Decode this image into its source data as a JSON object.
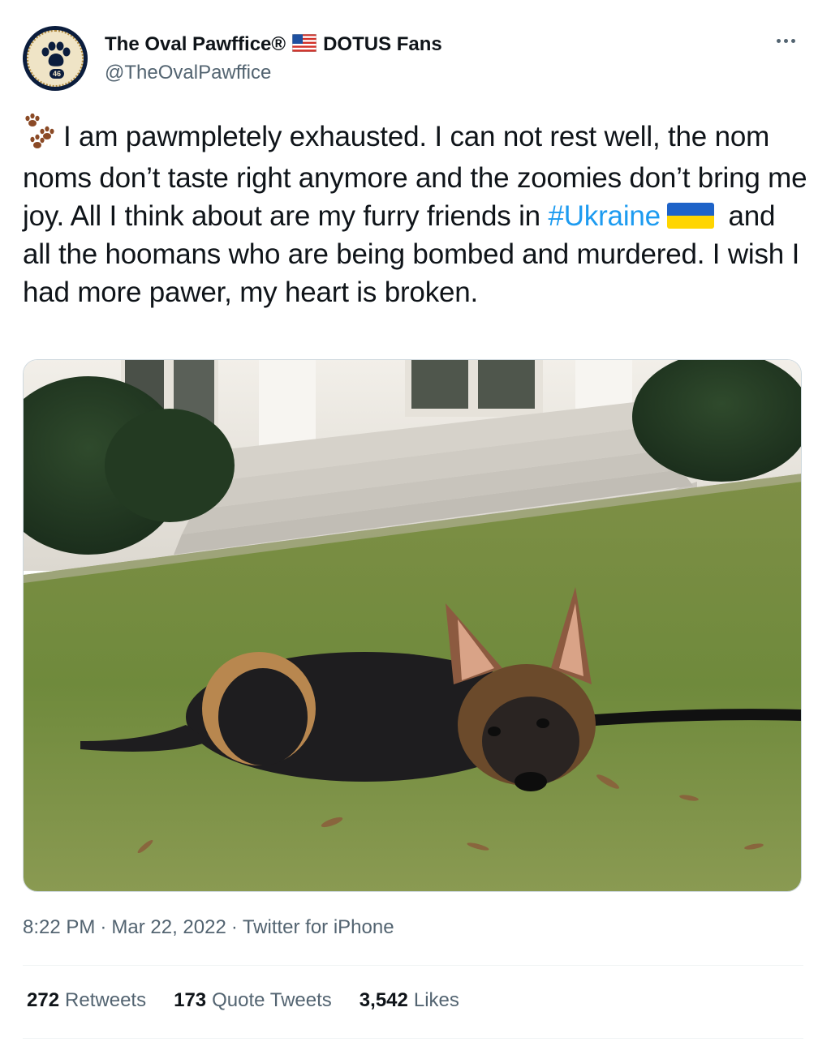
{
  "author": {
    "display_name_part1": "The Oval Pawffice®",
    "display_name_part2": "DOTUS Fans",
    "handle": "@TheOvalPawffice",
    "avatar_label": "46",
    "flag_icon": "us-flag-icon"
  },
  "tweet": {
    "text_part1": "I am pawmpletely exhausted. I can not rest well, the nom noms don’t taste right anymore and the zoomies don’t bring me joy. All I think about are my furry friends in ",
    "hashtag": "#Ukraine",
    "text_part2": " and all the hoomans who are being bombed and murdered. I wish I had more pawer, my heart is broken.",
    "leading_icon": "paw-prints-icon",
    "hashtag_color": "#1d9bf0"
  },
  "meta": {
    "time": "8:22 PM",
    "date": "Mar 22, 2022",
    "source": "Twitter for iPhone",
    "separator": "·"
  },
  "stats": {
    "retweets_count": "272",
    "retweets_label": "Retweets",
    "quotes_count": "173",
    "quotes_label": "Quote Tweets",
    "likes_count": "3,542",
    "likes_label": "Likes"
  },
  "colors": {
    "text_primary": "#0f1419",
    "text_secondary": "#536471",
    "link": "#1d9bf0",
    "divider": "#eff3f4"
  }
}
